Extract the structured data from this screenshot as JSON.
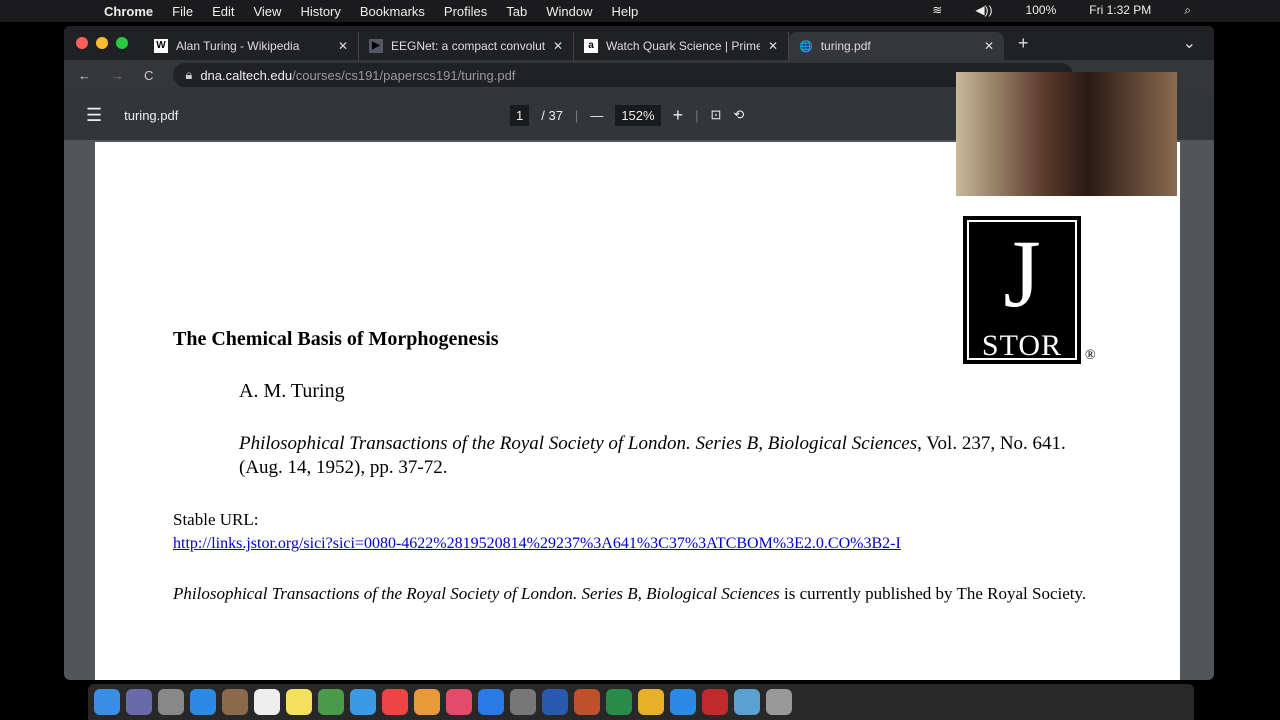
{
  "menubar": {
    "app": "Chrome",
    "items": [
      "File",
      "Edit",
      "View",
      "History",
      "Bookmarks",
      "Profiles",
      "Tab",
      "Window",
      "Help"
    ],
    "battery": "100%",
    "clock": "Fri 1:32 PM"
  },
  "tabs": [
    {
      "label": "Alan Turing - Wikipedia",
      "icon": "W"
    },
    {
      "label": "EEGNet: a compact convolutio",
      "icon": "▶"
    },
    {
      "label": "Watch Quark Science | Prime V",
      "icon": "a"
    },
    {
      "label": "turing.pdf",
      "icon": "🌐"
    }
  ],
  "address": {
    "domain": "dna.caltech.edu",
    "path": "/courses/cs191/paperscs191/turing.pdf"
  },
  "pdf": {
    "filename": "turing.pdf",
    "page": "1",
    "total": "/ 37",
    "zoom": "152%"
  },
  "doc": {
    "title": "The Chemical Basis of Morphogenesis",
    "author": "A. M. Turing",
    "journal": "Philosophical Transactions of the Royal Society of London. Series B, Biological Sciences",
    "citation_rest": ", Vol. 237, No. 641. (Aug. 14, 1952), pp. 37-72.",
    "stable_label": "Stable URL:",
    "stable_url": "http://links.jstor.org/sici?sici=0080-4622%2819520814%29237%3A641%3C37%3ATCBOM%3E2.0.CO%3B2-I",
    "publisher_journal": "Philosophical Transactions of the Royal Society of London. Series B, Biological Sciences",
    "publisher_rest": " is currently published by The Royal Society.",
    "logo": "JSTOR"
  }
}
